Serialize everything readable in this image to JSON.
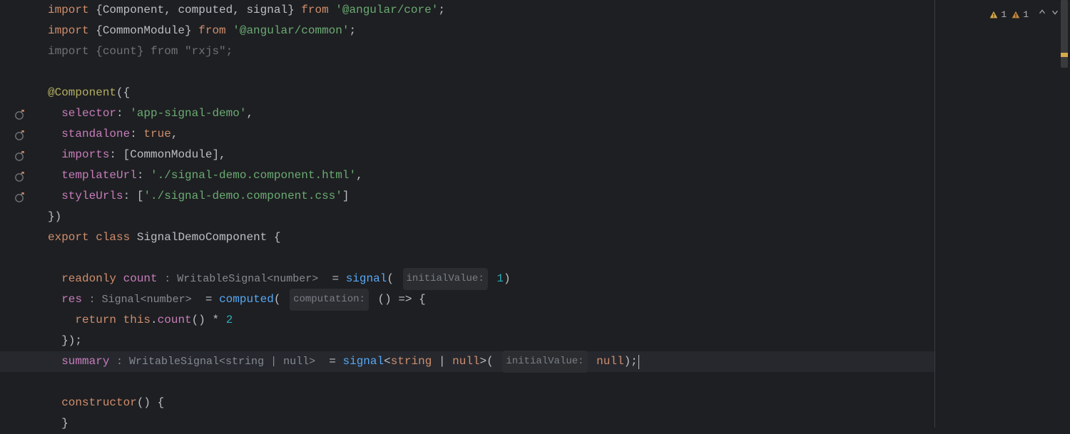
{
  "warnings": {
    "yellow_count": "1",
    "orange_count": "1"
  },
  "code": {
    "kw_import": "import",
    "kw_from": "from",
    "kw_export": "export",
    "kw_class": "class",
    "kw_readonly": "readonly",
    "kw_return": "return",
    "kw_constructor": "constructor",
    "kw_true": "true",
    "kw_null": "null",
    "kw_this": "this",
    "imp_Component": "Component",
    "imp_computed": "computed",
    "imp_signal": "signal",
    "imp_CommonModule": "CommonModule",
    "imp_count": "count",
    "mod_angular_core": "'@angular/core'",
    "mod_angular_common": "'@angular/common'",
    "mod_rxjs": "\"rxjs\"",
    "dec_Component": "@Component",
    "prop_selector": "selector",
    "val_selector": "'app-signal-demo'",
    "prop_standalone": "standalone",
    "prop_imports": "imports",
    "val_imports": "CommonModule",
    "prop_templateUrl": "templateUrl",
    "val_templateUrl": "'./signal-demo.component.html'",
    "prop_styleUrls": "styleUrls",
    "val_styleUrls": "'./signal-demo.component.css'",
    "class_name": "SignalDemoComponent",
    "field_count": "count",
    "hint_count_type": ": WritableSignal<number>",
    "call_signal": "signal",
    "hint_initialValue": "initialValue:",
    "val_count_init": "1",
    "field_res": "res",
    "hint_res_type": ": Signal<number>",
    "call_computed": "computed",
    "hint_computation": "computation:",
    "arrow": "() => {",
    "expr_count_call": "count",
    "op_mul": "*",
    "val_two": "2",
    "close_brace_paren": "});",
    "field_summary": "summary",
    "hint_summary_type": ": WritableSignal<string | null>",
    "generic_string_null": "<string | null>",
    "open_bracket": "(",
    "close_paren_semi": ");",
    "open_brace": "{",
    "close_brace": "}",
    "close_paren_brace": "})",
    "open_square": "[",
    "close_square": "]",
    "comma": ",",
    "semi": ";",
    "eq": "="
  },
  "icons": {
    "usage": "usage-hint-icon",
    "warning_yellow": "warning-triangle-yellow",
    "warning_orange": "warning-triangle-orange",
    "chevron_up": "chevron-up-icon",
    "chevron_down": "chevron-down-icon"
  }
}
